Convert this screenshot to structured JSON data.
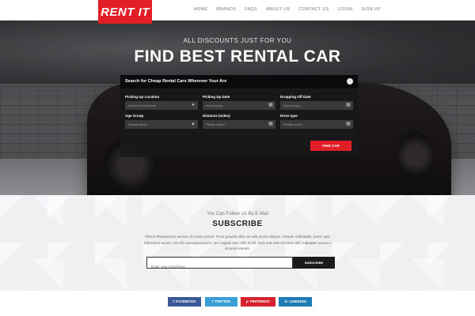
{
  "header": {
    "logo": "RENT IT",
    "nav": [
      "HOME",
      "BRANDS",
      "FAQS",
      "ABOUT US",
      "CONTACT US",
      "LOGIN",
      "SIGN UP"
    ]
  },
  "hero": {
    "eyebrow": "ALL DISCOUNTS JUST FOR YOU",
    "title": "FIND BEST RENTAL CAR"
  },
  "search": {
    "title": "Search for Cheap Rental Cars Wherever Your Are",
    "pickup_location": {
      "label": "Picking Up Location",
      "placeholder": "Airport or Anywhere",
      "icon": "map-pin-icon"
    },
    "pickup_date": {
      "label": "Picking Up Date",
      "placeholder": "dd/mm/yyyy",
      "icon": "calendar-icon"
    },
    "dropoff_date": {
      "label": "Dropping Off Date",
      "placeholder": "dd/mm/yyyy",
      "icon": "calendar-icon"
    },
    "age_group": {
      "label": "Age Group",
      "placeholder": "Please select",
      "icon": "user-icon"
    },
    "distance": {
      "label": "Distance (miles)",
      "placeholder": "Please select",
      "icon": "grid-icon"
    },
    "drive_type": {
      "label": "Drive type",
      "placeholder": "Please select",
      "icon": "grid-icon"
    },
    "button": "FIND CAR"
  },
  "subscribe": {
    "small": "You Can Follow Us By E Mail",
    "heading": "SUBSCRIBE",
    "description": "This is Photoshop's version of Lorem Ipsum. Proin gravida nibh vel velit auctor aliquet. Aenean sollicitudin, lorem quis bibendum auctor, nisi elit consequat ipsum, nec sagittis sem nibh id elit. Duis sed odio sit amet nibh vulputate cursus a sit amet mauris.",
    "email_placeholder": "Enter your email here",
    "button": "SUBSCRIBE"
  },
  "social": {
    "buttons": [
      {
        "label": "FACEBOOK",
        "glyph": "f",
        "color": "#3b5998"
      },
      {
        "label": "TWITTER",
        "glyph": "t",
        "color": "#3a9fd6"
      },
      {
        "label": "PINTEREST",
        "glyph": "p",
        "color": "#d7232f"
      },
      {
        "label": "LINKEDIN",
        "glyph": "in",
        "color": "#1e7bb5"
      }
    ]
  },
  "colors": {
    "brand_red": "#e21f26",
    "panel_dark": "#18181a"
  }
}
